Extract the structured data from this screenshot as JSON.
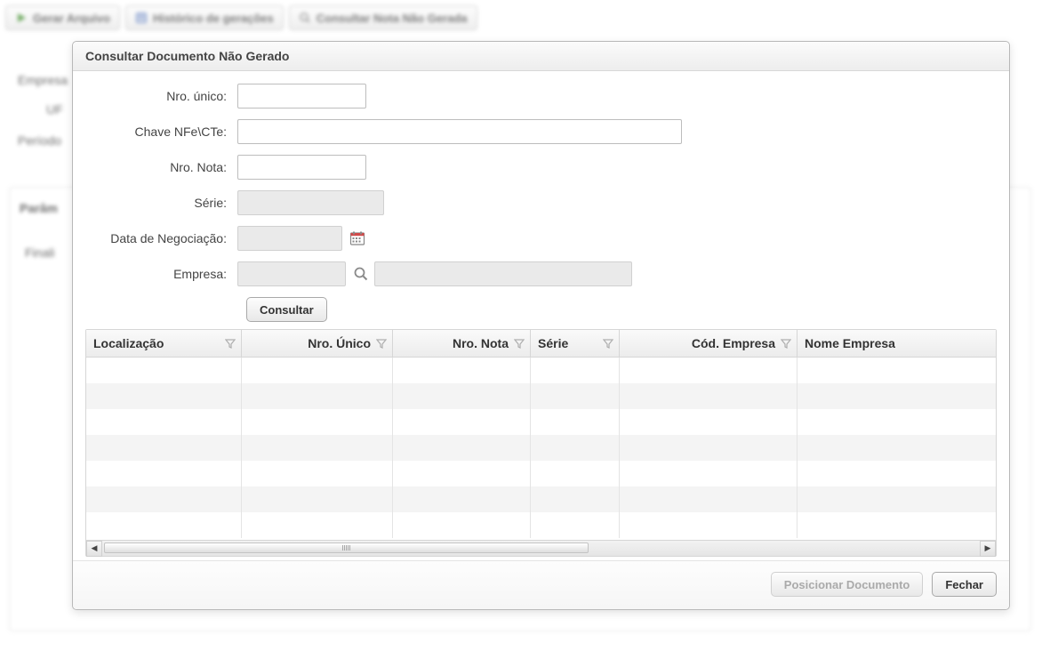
{
  "background": {
    "toolbar": {
      "gerar": "Gerar Arquivo",
      "historico": "Histórico de gerações",
      "consultar": "Consultar Nota Não Gerada"
    },
    "labels": {
      "empresa": "Empresa",
      "uf": "UF",
      "periodo": "Período",
      "parametros": "Parâm",
      "finali": "Finali"
    }
  },
  "modal": {
    "title": "Consultar Documento Não Gerado",
    "fields": {
      "nro_unico": {
        "label": "Nro. único:",
        "value": ""
      },
      "chave": {
        "label": "Chave NFe\\CTe:",
        "value": ""
      },
      "nro_nota": {
        "label": "Nro. Nota:",
        "value": ""
      },
      "serie": {
        "label": "Série:",
        "value": ""
      },
      "data_neg": {
        "label": "Data de Negociação:",
        "value": ""
      },
      "empresa": {
        "label": "Empresa:",
        "code": "",
        "desc": ""
      }
    },
    "consultar_btn": "Consultar",
    "grid": {
      "columns": {
        "loc": "Localização",
        "nunic": "Nro. Único",
        "nnota": "Nro. Nota",
        "serie": "Série",
        "cemp": "Cód. Empresa",
        "nemp": "Nome Empresa"
      }
    },
    "footer": {
      "posicionar": "Posicionar Documento",
      "fechar": "Fechar"
    }
  }
}
